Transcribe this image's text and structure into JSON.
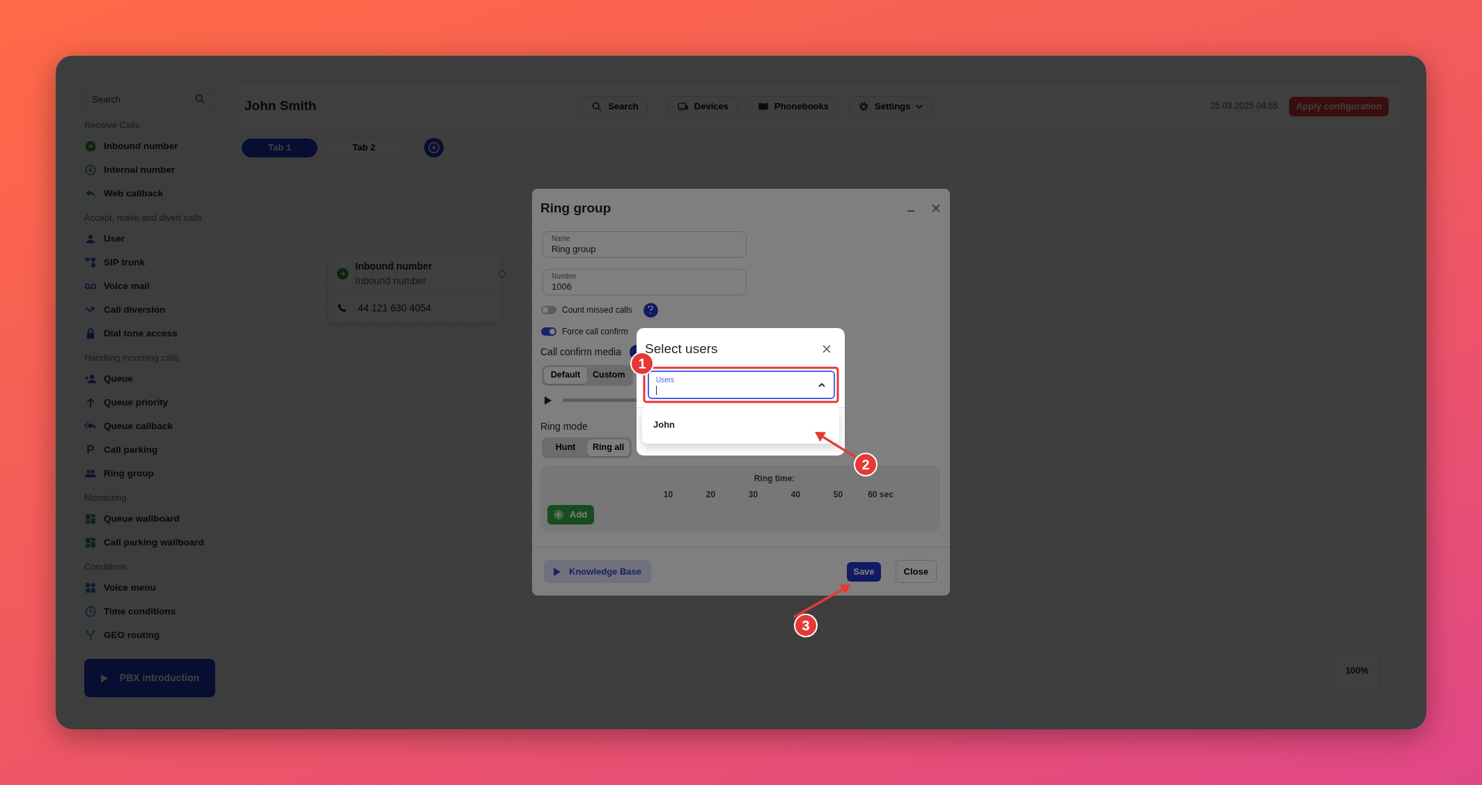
{
  "sidebar": {
    "search": {
      "placeholder": "Search"
    },
    "sections": [
      {
        "heading": "Receive Calls",
        "items": [
          {
            "label": "Inbound number"
          },
          {
            "label": "Internal number"
          },
          {
            "label": "Web callback"
          }
        ]
      },
      {
        "heading": "Accept, make and divert calls",
        "items": [
          {
            "label": "User"
          },
          {
            "label": "SIP trunk"
          },
          {
            "label": "Voice mail"
          },
          {
            "label": "Call diversion"
          },
          {
            "label": "Dial tone access"
          }
        ]
      },
      {
        "heading": "Handling incoming calls",
        "items": [
          {
            "label": "Queue"
          },
          {
            "label": "Queue priority"
          },
          {
            "label": "Queue callback"
          },
          {
            "label": "Call parking",
            "glyph": "P"
          },
          {
            "label": "Ring group"
          }
        ]
      },
      {
        "heading": "Monitoring",
        "items": [
          {
            "label": "Queue wallboard"
          },
          {
            "label": "Call parking wallboard"
          }
        ]
      },
      {
        "heading": "Conditions",
        "items": [
          {
            "label": "Voice menu"
          },
          {
            "label": "Time conditions"
          },
          {
            "label": "GEO routing"
          }
        ]
      }
    ],
    "intro_button": "PBX introduction"
  },
  "header": {
    "title": "John Smith",
    "buttons": [
      {
        "label": "Search"
      },
      {
        "label": "Devices"
      },
      {
        "label": "Phonebooks"
      },
      {
        "label": "Settings"
      }
    ],
    "datetime": "25.03.2025 04:55",
    "apply_button": "Apply configuration"
  },
  "tabs": [
    {
      "label": "Tab 1",
      "selected": true
    },
    {
      "label": "Tab 2",
      "selected": false
    }
  ],
  "node": {
    "title": "Inbound number",
    "subtitle": "Inbound number",
    "phone": "44 121 630 4054"
  },
  "zoom_level": "100%",
  "ring_group_dialog": {
    "title": "Ring group",
    "fields": [
      {
        "label": "Name",
        "value": "Ring group"
      },
      {
        "label": "Number",
        "value": "1006"
      }
    ],
    "toggles": [
      {
        "label": "Count missed calls",
        "on": false
      },
      {
        "label": "Force call confirm",
        "on": true
      }
    ],
    "media": {
      "label": "Call confirm media",
      "options": [
        {
          "label": "Default",
          "selected": true
        },
        {
          "label": "Custom",
          "selected": false
        }
      ]
    },
    "ring_mode": {
      "label": "Ring mode",
      "options": [
        {
          "label": "Hunt",
          "selected": false
        },
        {
          "label": "Ring all",
          "selected": true
        }
      ]
    },
    "ring_time": {
      "label": "Ring time:",
      "ticks": [
        "10",
        "20",
        "30",
        "40",
        "50",
        "60 sec"
      ]
    },
    "add_button": "Add",
    "knowledge_button": "Knowledge Base",
    "save_button": "Save",
    "close_button": "Close"
  },
  "select_users_dialog": {
    "title": "Select users",
    "field": {
      "label": "Users",
      "focused": true
    },
    "options": [
      {
        "label": "John"
      }
    ]
  },
  "annotations": [
    {
      "number": "1"
    },
    {
      "number": "2"
    },
    {
      "number": "3"
    }
  ]
}
